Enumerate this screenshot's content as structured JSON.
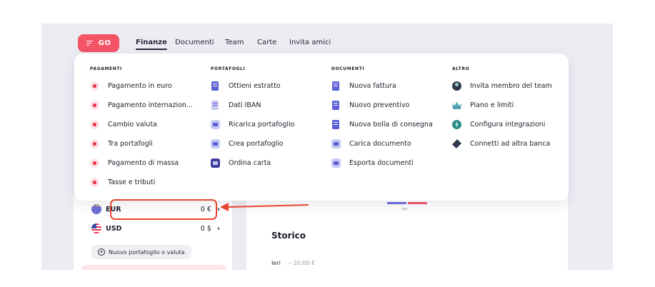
{
  "nav": {
    "go_label": "GO",
    "tabs": [
      "Finanze",
      "Documenti",
      "Team",
      "Carte",
      "Invita amici"
    ],
    "active_tab": "Finanze"
  },
  "menu": {
    "pagamenti": {
      "title": "PAGAMENTI",
      "items": [
        "Pagamento in euro",
        "Pagamento internazion...",
        "Cambio valuta",
        "Tra portafogli",
        "Pagamento di massa",
        "Tasse e tributi"
      ]
    },
    "portafogli": {
      "title": "PORTAFOGLI",
      "items": [
        "Ottieni estratto",
        "Dati IBAN",
        "Ricarica portafoglio",
        "Crea portafoglio",
        "Ordina carta"
      ]
    },
    "documenti": {
      "title": "DOCUMENTI",
      "items": [
        "Nuova fattura",
        "Nuovo preventivo",
        "Nuova bolla di consegna",
        "Carica documento",
        "Esporta documenti"
      ]
    },
    "altro": {
      "title": "ALTRO",
      "items": [
        "Invita membro del team",
        "Piano e limiti",
        "Configura integrazioni",
        "Connetti ad altra banca"
      ]
    }
  },
  "wallets": [
    {
      "code": "EUR",
      "amount": "0 €",
      "flag": "eu-flag-icon"
    },
    {
      "code": "USD",
      "amount": "0 $",
      "flag": "us-flag-icon"
    }
  ],
  "new_wallet_label": "Nuovo portafoglio o valuta",
  "chart": {
    "month_label": "apr",
    "colors": {
      "income": "#6a6de0",
      "expense": "#f45466"
    }
  },
  "history": {
    "title": "Storico",
    "day": "Ieri",
    "amount": "– 20,00 €"
  },
  "annotation": {
    "highlighted_item": "Tasse e tributi",
    "color": "#e8452f"
  },
  "colors": {
    "brand": "#f45466",
    "text": "#1d1d2b"
  }
}
